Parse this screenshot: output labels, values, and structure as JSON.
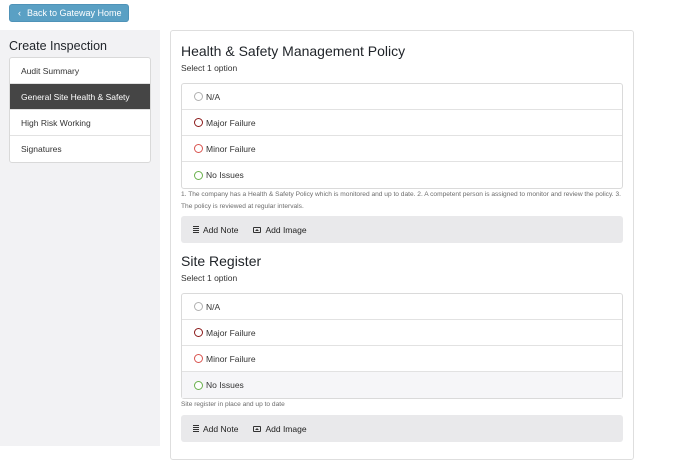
{
  "header": {
    "back_label": "Back to Gateway Home"
  },
  "sidebar": {
    "title": "Create Inspection",
    "items": [
      {
        "label": "Audit Summary"
      },
      {
        "label": "General Site Health & Safety"
      },
      {
        "label": "High Risk Working"
      },
      {
        "label": "Signatures"
      }
    ]
  },
  "sections": [
    {
      "title": "Health & Safety Management Policy",
      "subtitle": "Select 1 option",
      "options": [
        "N/A",
        "Major Failure",
        "Minor Failure",
        "No Issues"
      ],
      "help": "1. The company has a Health & Safety Policy which is monitored and up to date. 2. A competent person is assigned to monitor and review the policy. 3. The policy is reviewed at regular intervals.",
      "actions": {
        "note": "Add Note",
        "image": "Add Image"
      }
    },
    {
      "title": "Site Register",
      "subtitle": "Select 1 option",
      "options": [
        "N/A",
        "Major Failure",
        "Minor Failure",
        "No Issues"
      ],
      "help": "Site register in place and up to date",
      "actions": {
        "note": "Add Note",
        "image": "Add Image"
      }
    }
  ],
  "colors": {
    "back_button": "#5aa0c4",
    "active_nav": "#454545",
    "major": "#8b1a1a",
    "minor": "#d9534f",
    "ok": "#6ab04c"
  },
  "icons": [
    "chevron-left-icon",
    "note-icon",
    "image-icon",
    "radio-icon"
  ]
}
